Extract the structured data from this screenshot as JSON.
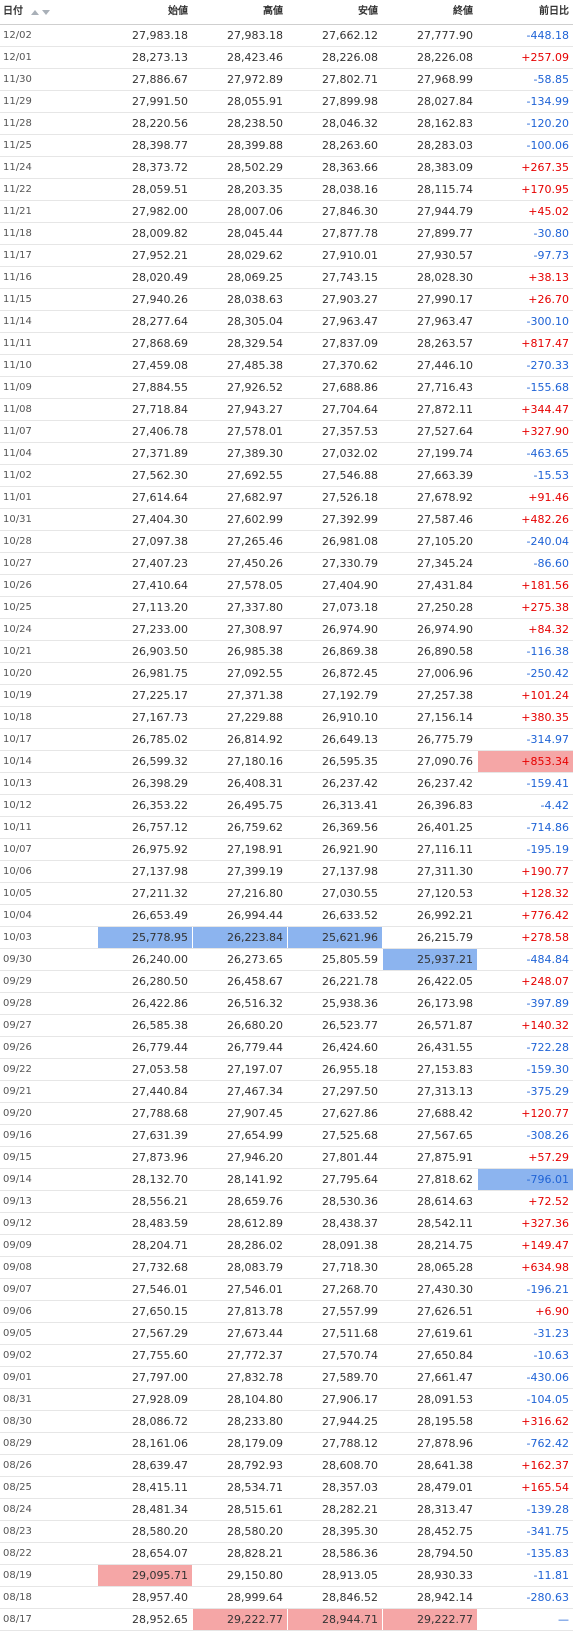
{
  "table": {
    "headers": {
      "date": "日付",
      "open": "始値",
      "high": "高値",
      "low": "安値",
      "close": "終値",
      "change": "前日比"
    },
    "rows": [
      {
        "date": "12/02",
        "open": "27,983.18",
        "high": "27,983.18",
        "low": "27,662.12",
        "close": "27,777.90",
        "change": "-448.18"
      },
      {
        "date": "12/01",
        "open": "28,273.13",
        "high": "28,423.46",
        "low": "28,226.08",
        "close": "28,226.08",
        "change": "+257.09"
      },
      {
        "date": "11/30",
        "open": "27,886.67",
        "high": "27,972.89",
        "low": "27,802.71",
        "close": "27,968.99",
        "change": "-58.85"
      },
      {
        "date": "11/29",
        "open": "27,991.50",
        "high": "28,055.91",
        "low": "27,899.98",
        "close": "28,027.84",
        "change": "-134.99"
      },
      {
        "date": "11/28",
        "open": "28,220.56",
        "high": "28,238.50",
        "low": "28,046.32",
        "close": "28,162.83",
        "change": "-120.20"
      },
      {
        "date": "11/25",
        "open": "28,398.77",
        "high": "28,399.88",
        "low": "28,263.60",
        "close": "28,283.03",
        "change": "-100.06"
      },
      {
        "date": "11/24",
        "open": "28,373.72",
        "high": "28,502.29",
        "low": "28,363.66",
        "close": "28,383.09",
        "change": "+267.35"
      },
      {
        "date": "11/22",
        "open": "28,059.51",
        "high": "28,203.35",
        "low": "28,038.16",
        "close": "28,115.74",
        "change": "+170.95"
      },
      {
        "date": "11/21",
        "open": "27,982.00",
        "high": "28,007.06",
        "low": "27,846.30",
        "close": "27,944.79",
        "change": "+45.02"
      },
      {
        "date": "11/18",
        "open": "28,009.82",
        "high": "28,045.44",
        "low": "27,877.78",
        "close": "27,899.77",
        "change": "-30.80"
      },
      {
        "date": "11/17",
        "open": "27,952.21",
        "high": "28,029.62",
        "low": "27,910.01",
        "close": "27,930.57",
        "change": "-97.73"
      },
      {
        "date": "11/16",
        "open": "28,020.49",
        "high": "28,069.25",
        "low": "27,743.15",
        "close": "28,028.30",
        "change": "+38.13"
      },
      {
        "date": "11/15",
        "open": "27,940.26",
        "high": "28,038.63",
        "low": "27,903.27",
        "close": "27,990.17",
        "change": "+26.70"
      },
      {
        "date": "11/14",
        "open": "28,277.64",
        "high": "28,305.04",
        "low": "27,963.47",
        "close": "27,963.47",
        "change": "-300.10"
      },
      {
        "date": "11/11",
        "open": "27,868.69",
        "high": "28,329.54",
        "low": "27,837.09",
        "close": "28,263.57",
        "change": "+817.47"
      },
      {
        "date": "11/10",
        "open": "27,459.08",
        "high": "27,485.38",
        "low": "27,370.62",
        "close": "27,446.10",
        "change": "-270.33"
      },
      {
        "date": "11/09",
        "open": "27,884.55",
        "high": "27,926.52",
        "low": "27,688.86",
        "close": "27,716.43",
        "change": "-155.68"
      },
      {
        "date": "11/08",
        "open": "27,718.84",
        "high": "27,943.27",
        "low": "27,704.64",
        "close": "27,872.11",
        "change": "+344.47"
      },
      {
        "date": "11/07",
        "open": "27,406.78",
        "high": "27,578.01",
        "low": "27,357.53",
        "close": "27,527.64",
        "change": "+327.90"
      },
      {
        "date": "11/04",
        "open": "27,371.89",
        "high": "27,389.30",
        "low": "27,032.02",
        "close": "27,199.74",
        "change": "-463.65"
      },
      {
        "date": "11/02",
        "open": "27,562.30",
        "high": "27,692.55",
        "low": "27,546.88",
        "close": "27,663.39",
        "change": "-15.53"
      },
      {
        "date": "11/01",
        "open": "27,614.64",
        "high": "27,682.97",
        "low": "27,526.18",
        "close": "27,678.92",
        "change": "+91.46"
      },
      {
        "date": "10/31",
        "open": "27,404.30",
        "high": "27,602.99",
        "low": "27,392.99",
        "close": "27,587.46",
        "change": "+482.26"
      },
      {
        "date": "10/28",
        "open": "27,097.38",
        "high": "27,265.46",
        "low": "26,981.08",
        "close": "27,105.20",
        "change": "-240.04"
      },
      {
        "date": "10/27",
        "open": "27,407.23",
        "high": "27,450.26",
        "low": "27,330.79",
        "close": "27,345.24",
        "change": "-86.60"
      },
      {
        "date": "10/26",
        "open": "27,410.64",
        "high": "27,578.05",
        "low": "27,404.90",
        "close": "27,431.84",
        "change": "+181.56"
      },
      {
        "date": "10/25",
        "open": "27,113.20",
        "high": "27,337.80",
        "low": "27,073.18",
        "close": "27,250.28",
        "change": "+275.38"
      },
      {
        "date": "10/24",
        "open": "27,233.00",
        "high": "27,308.97",
        "low": "26,974.90",
        "close": "26,974.90",
        "change": "+84.32"
      },
      {
        "date": "10/21",
        "open": "26,903.50",
        "high": "26,985.38",
        "low": "26,869.38",
        "close": "26,890.58",
        "change": "-116.38"
      },
      {
        "date": "10/20",
        "open": "26,981.75",
        "high": "27,092.55",
        "low": "26,872.45",
        "close": "27,006.96",
        "change": "-250.42"
      },
      {
        "date": "10/19",
        "open": "27,225.17",
        "high": "27,371.38",
        "low": "27,192.79",
        "close": "27,257.38",
        "change": "+101.24"
      },
      {
        "date": "10/18",
        "open": "27,167.73",
        "high": "27,229.88",
        "low": "26,910.10",
        "close": "27,156.14",
        "change": "+380.35"
      },
      {
        "date": "10/17",
        "open": "26,785.02",
        "high": "26,814.92",
        "low": "26,649.13",
        "close": "26,775.79",
        "change": "-314.97"
      },
      {
        "date": "10/14",
        "open": "26,599.32",
        "high": "27,180.16",
        "low": "26,595.35",
        "close": "27,090.76",
        "change": "+853.34",
        "highlight": {
          "change": "max"
        }
      },
      {
        "date": "10/13",
        "open": "26,398.29",
        "high": "26,408.31",
        "low": "26,237.42",
        "close": "26,237.42",
        "change": "-159.41"
      },
      {
        "date": "10/12",
        "open": "26,353.22",
        "high": "26,495.75",
        "low": "26,313.41",
        "close": "26,396.83",
        "change": "-4.42"
      },
      {
        "date": "10/11",
        "open": "26,757.12",
        "high": "26,759.62",
        "low": "26,369.56",
        "close": "26,401.25",
        "change": "-714.86"
      },
      {
        "date": "10/07",
        "open": "26,975.92",
        "high": "27,198.91",
        "low": "26,921.90",
        "close": "27,116.11",
        "change": "-195.19"
      },
      {
        "date": "10/06",
        "open": "27,137.98",
        "high": "27,399.19",
        "low": "27,137.98",
        "close": "27,311.30",
        "change": "+190.77"
      },
      {
        "date": "10/05",
        "open": "27,211.32",
        "high": "27,216.80",
        "low": "27,030.55",
        "close": "27,120.53",
        "change": "+128.32"
      },
      {
        "date": "10/04",
        "open": "26,653.49",
        "high": "26,994.44",
        "low": "26,633.52",
        "close": "26,992.21",
        "change": "+776.42"
      },
      {
        "date": "10/03",
        "open": "25,778.95",
        "high": "26,223.84",
        "low": "25,621.96",
        "close": "26,215.79",
        "change": "+278.58",
        "highlight": {
          "open": "min",
          "high": "min",
          "low": "min"
        }
      },
      {
        "date": "09/30",
        "open": "26,240.00",
        "high": "26,273.65",
        "low": "25,805.59",
        "close": "25,937.21",
        "change": "-484.84",
        "highlight": {
          "close": "min"
        }
      },
      {
        "date": "09/29",
        "open": "26,280.50",
        "high": "26,458.67",
        "low": "26,221.78",
        "close": "26,422.05",
        "change": "+248.07"
      },
      {
        "date": "09/28",
        "open": "26,422.86",
        "high": "26,516.32",
        "low": "25,938.36",
        "close": "26,173.98",
        "change": "-397.89"
      },
      {
        "date": "09/27",
        "open": "26,585.38",
        "high": "26,680.20",
        "low": "26,523.77",
        "close": "26,571.87",
        "change": "+140.32"
      },
      {
        "date": "09/26",
        "open": "26,779.44",
        "high": "26,779.44",
        "low": "26,424.60",
        "close": "26,431.55",
        "change": "-722.28"
      },
      {
        "date": "09/22",
        "open": "27,053.58",
        "high": "27,197.07",
        "low": "26,955.18",
        "close": "27,153.83",
        "change": "-159.30"
      },
      {
        "date": "09/21",
        "open": "27,440.84",
        "high": "27,467.34",
        "low": "27,297.50",
        "close": "27,313.13",
        "change": "-375.29"
      },
      {
        "date": "09/20",
        "open": "27,788.68",
        "high": "27,907.45",
        "low": "27,627.86",
        "close": "27,688.42",
        "change": "+120.77"
      },
      {
        "date": "09/16",
        "open": "27,631.39",
        "high": "27,654.99",
        "low": "27,525.68",
        "close": "27,567.65",
        "change": "-308.26"
      },
      {
        "date": "09/15",
        "open": "27,873.96",
        "high": "27,946.20",
        "low": "27,801.44",
        "close": "27,875.91",
        "change": "+57.29"
      },
      {
        "date": "09/14",
        "open": "28,132.70",
        "high": "28,141.92",
        "low": "27,795.64",
        "close": "27,818.62",
        "change": "-796.01",
        "highlight": {
          "change": "min"
        }
      },
      {
        "date": "09/13",
        "open": "28,556.21",
        "high": "28,659.76",
        "low": "28,530.36",
        "close": "28,614.63",
        "change": "+72.52"
      },
      {
        "date": "09/12",
        "open": "28,483.59",
        "high": "28,612.89",
        "low": "28,438.37",
        "close": "28,542.11",
        "change": "+327.36"
      },
      {
        "date": "09/09",
        "open": "28,204.71",
        "high": "28,286.02",
        "low": "28,091.38",
        "close": "28,214.75",
        "change": "+149.47"
      },
      {
        "date": "09/08",
        "open": "27,732.68",
        "high": "28,083.79",
        "low": "27,718.30",
        "close": "28,065.28",
        "change": "+634.98"
      },
      {
        "date": "09/07",
        "open": "27,546.01",
        "high": "27,546.01",
        "low": "27,268.70",
        "close": "27,430.30",
        "change": "-196.21"
      },
      {
        "date": "09/06",
        "open": "27,650.15",
        "high": "27,813.78",
        "low": "27,557.99",
        "close": "27,626.51",
        "change": "+6.90"
      },
      {
        "date": "09/05",
        "open": "27,567.29",
        "high": "27,673.44",
        "low": "27,511.68",
        "close": "27,619.61",
        "change": "-31.23"
      },
      {
        "date": "09/02",
        "open": "27,755.60",
        "high": "27,772.37",
        "low": "27,570.74",
        "close": "27,650.84",
        "change": "-10.63"
      },
      {
        "date": "09/01",
        "open": "27,797.00",
        "high": "27,832.78",
        "low": "27,589.70",
        "close": "27,661.47",
        "change": "-430.06"
      },
      {
        "date": "08/31",
        "open": "27,928.09",
        "high": "28,104.80",
        "low": "27,906.17",
        "close": "28,091.53",
        "change": "-104.05"
      },
      {
        "date": "08/30",
        "open": "28,086.72",
        "high": "28,233.80",
        "low": "27,944.25",
        "close": "28,195.58",
        "change": "+316.62"
      },
      {
        "date": "08/29",
        "open": "28,161.06",
        "high": "28,179.09",
        "low": "27,788.12",
        "close": "27,878.96",
        "change": "-762.42"
      },
      {
        "date": "08/26",
        "open": "28,639.47",
        "high": "28,792.93",
        "low": "28,608.70",
        "close": "28,641.38",
        "change": "+162.37"
      },
      {
        "date": "08/25",
        "open": "28,415.11",
        "high": "28,534.71",
        "low": "28,357.03",
        "close": "28,479.01",
        "change": "+165.54"
      },
      {
        "date": "08/24",
        "open": "28,481.34",
        "high": "28,515.61",
        "low": "28,282.21",
        "close": "28,313.47",
        "change": "-139.28"
      },
      {
        "date": "08/23",
        "open": "28,580.20",
        "high": "28,580.20",
        "low": "28,395.30",
        "close": "28,452.75",
        "change": "-341.75"
      },
      {
        "date": "08/22",
        "open": "28,654.07",
        "high": "28,828.21",
        "low": "28,586.36",
        "close": "28,794.50",
        "change": "-135.83"
      },
      {
        "date": "08/19",
        "open": "29,095.71",
        "high": "29,150.80",
        "low": "28,913.05",
        "close": "28,930.33",
        "change": "-11.81",
        "highlight": {
          "open": "max"
        }
      },
      {
        "date": "08/18",
        "open": "28,957.40",
        "high": "28,999.64",
        "low": "28,846.52",
        "close": "28,942.14",
        "change": "-280.63"
      },
      {
        "date": "08/17",
        "open": "28,952.65",
        "high": "29,222.77",
        "low": "28,944.71",
        "close": "29,222.77",
        "change": "—",
        "highlight": {
          "high": "max",
          "low": "max",
          "close": "max"
        }
      }
    ]
  },
  "colors": {
    "positive_change": "#e60000",
    "negative_change": "#1f63d6",
    "max_highlight": "#f5a6a6",
    "min_highlight": "#8cb4ef"
  },
  "icons": {
    "sort_ascending": "sort-ascending-icon",
    "sort_descending": "sort-descending-icon"
  }
}
